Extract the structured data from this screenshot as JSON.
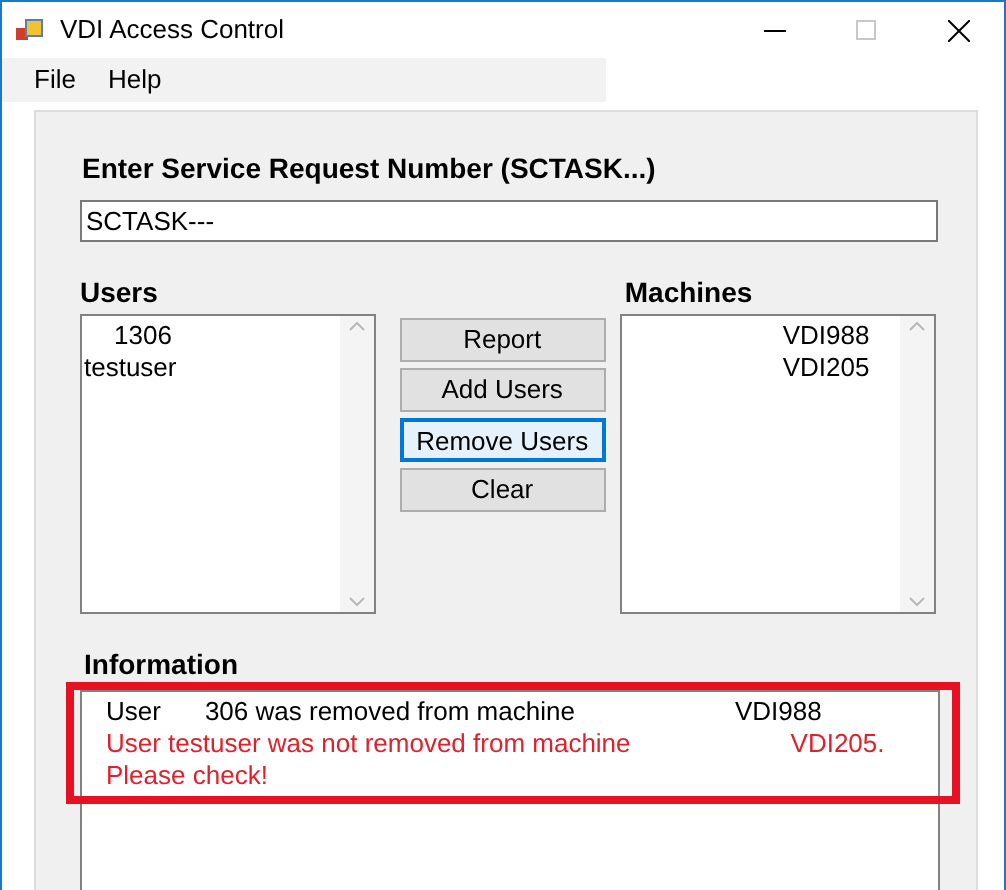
{
  "window": {
    "title": "VDI Access Control",
    "maximize_disabled": true
  },
  "menu": [
    "File",
    "Help"
  ],
  "request": {
    "label": "Enter Service Request Number (SCTASK...)",
    "value": "SCTASK---"
  },
  "users": {
    "label": "Users",
    "items": [
      "1306",
      "testuser"
    ]
  },
  "machines": {
    "label": "Machines",
    "items": [
      "VDI988",
      "VDI205"
    ]
  },
  "buttons": [
    {
      "label": "Report",
      "focused": false
    },
    {
      "label": "Add Users",
      "focused": false
    },
    {
      "label": "Remove Users",
      "focused": true
    },
    {
      "label": "Clear",
      "focused": false
    }
  ],
  "information": {
    "label": "Information",
    "highlighted": true,
    "messages": [
      {
        "kind": "success",
        "parts": [
          "User",
          "306 was removed from machine",
          "VDI988"
        ]
      },
      {
        "kind": "error",
        "parts": [
          "User testuser was not removed from machine",
          "VDI205."
        ]
      },
      {
        "kind": "error",
        "parts": [
          "Please check!"
        ]
      }
    ]
  }
}
